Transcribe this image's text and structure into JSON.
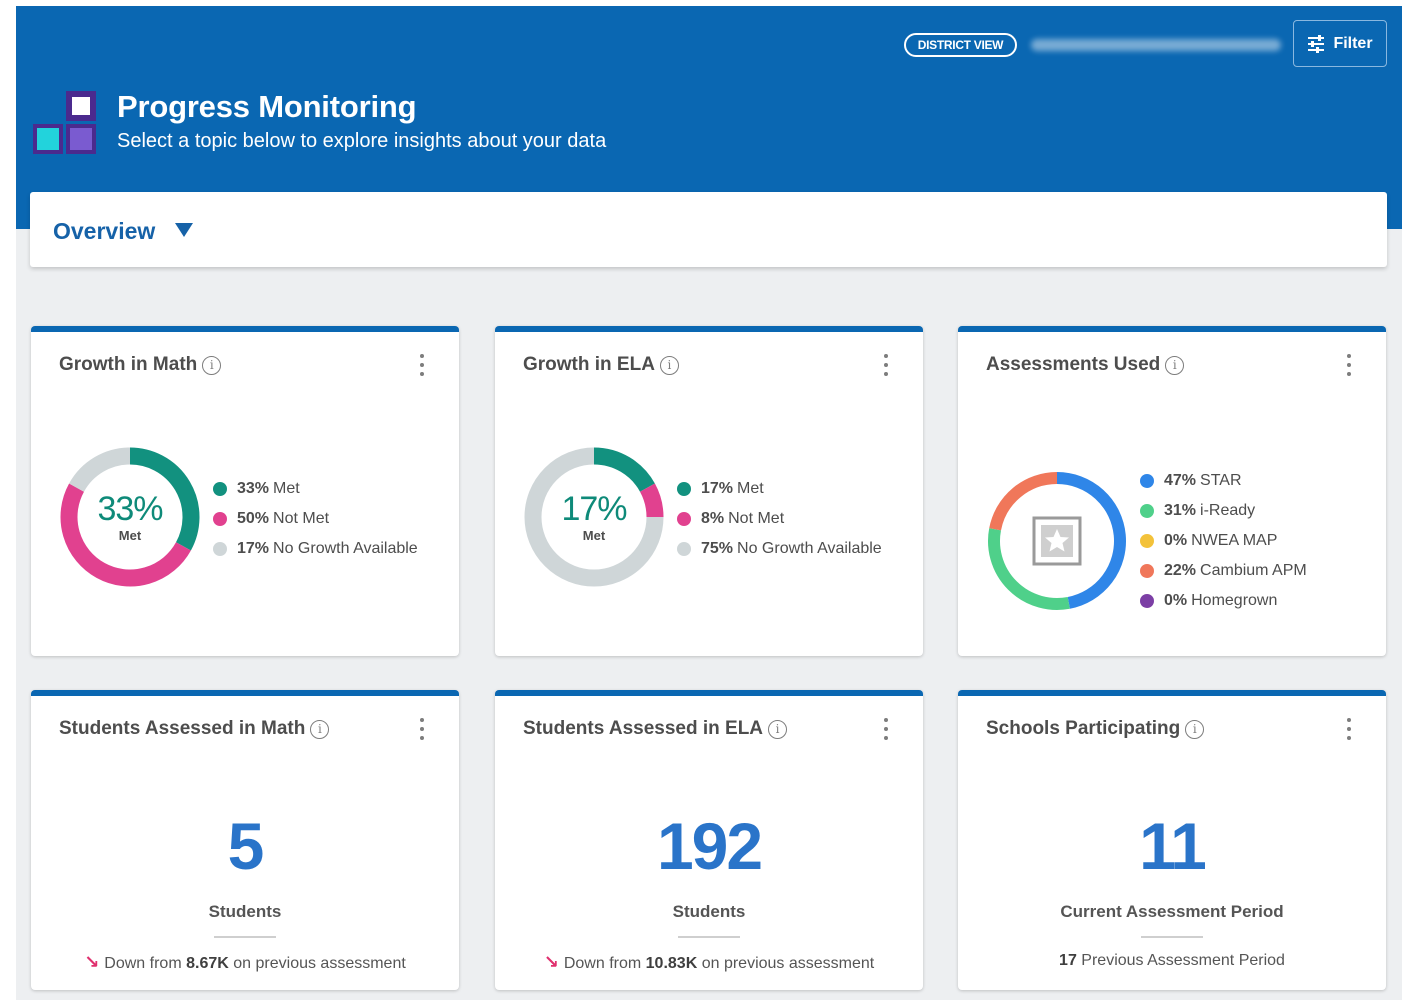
{
  "header": {
    "title": "Progress Monitoring",
    "subtitle": "Select a topic below to explore insights about your data",
    "district_view_label": "DISTRICT VIEW",
    "filter_label": "Filter"
  },
  "overview": {
    "label": "Overview"
  },
  "cards": {
    "growth_math": {
      "title": "Growth in Math",
      "center_pct": "33%",
      "center_label": "Met",
      "legend": [
        {
          "pct": "33%",
          "label": "Met",
          "color": "#12917f",
          "value": 33
        },
        {
          "pct": "50%",
          "label": "Not Met",
          "color": "#e1418f",
          "value": 50
        },
        {
          "pct": "17%",
          "label": "No Growth Available",
          "color": "#cfd6d8",
          "value": 17
        }
      ]
    },
    "growth_ela": {
      "title": "Growth in ELA",
      "center_pct": "17%",
      "center_label": "Met",
      "legend": [
        {
          "pct": "17%",
          "label": "Met",
          "color": "#12917f",
          "value": 17
        },
        {
          "pct": "8%",
          "label": "Not Met",
          "color": "#e1418f",
          "value": 8
        },
        {
          "pct": "75%",
          "label": "No Growth Available",
          "color": "#cfd6d8",
          "value": 75
        }
      ]
    },
    "assessments": {
      "title": "Assessments Used",
      "legend": [
        {
          "pct": "47%",
          "label": "STAR",
          "color": "#2f86e8",
          "value": 47
        },
        {
          "pct": "31%",
          "label": "i-Ready",
          "color": "#4fd08a",
          "value": 31
        },
        {
          "pct": "0%",
          "label": "NWEA MAP",
          "color": "#f3c23a",
          "value": 0
        },
        {
          "pct": "22%",
          "label": "Cambium APM",
          "color": "#f0775a",
          "value": 22
        },
        {
          "pct": "0%",
          "label": "Homegrown",
          "color": "#7c3fa5",
          "value": 0
        }
      ]
    },
    "students_math": {
      "title": "Students Assessed in Math",
      "value": "5",
      "label": "Students",
      "foot_prefix": "Down from",
      "foot_value": "8.67K",
      "foot_suffix": "on previous assessment"
    },
    "students_ela": {
      "title": "Students Assessed in ELA",
      "value": "192",
      "label": "Students",
      "foot_prefix": "Down from",
      "foot_value": "10.83K",
      "foot_suffix": "on previous assessment"
    },
    "schools": {
      "title": "Schools Participating",
      "value": "11",
      "label": "Current Assessment Period",
      "foot_value": "17",
      "foot_suffix": "Previous Assessment Period"
    }
  }
}
